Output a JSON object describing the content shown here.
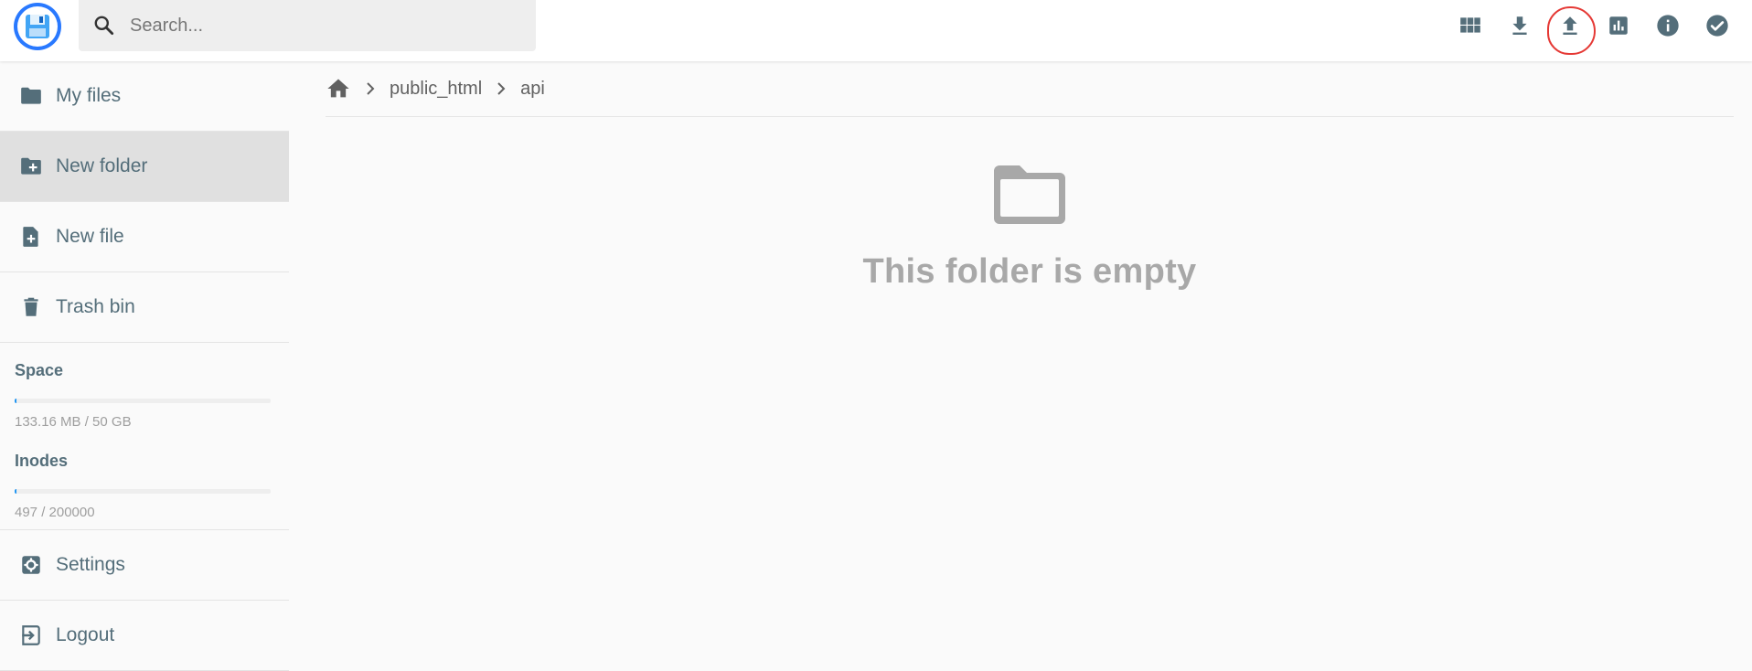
{
  "header": {
    "logo": "floppy-disk-logo",
    "search_placeholder": "Search...",
    "toolbar": [
      {
        "name": "toggle-view-button",
        "icon": "view-module-icon",
        "title": "Switch view"
      },
      {
        "name": "download-button",
        "icon": "download-icon",
        "title": "Download"
      },
      {
        "name": "upload-button",
        "icon": "upload-icon",
        "title": "Upload"
      },
      {
        "name": "statistics-button",
        "icon": "bar-chart-icon",
        "title": "Info"
      },
      {
        "name": "info-button",
        "icon": "info-icon",
        "title": "Info"
      },
      {
        "name": "select-multiple-button",
        "icon": "check-circle-icon",
        "title": "Select multiple"
      }
    ],
    "annotation_color": "#e53935"
  },
  "sidebar": {
    "items": [
      {
        "label": "My files",
        "icon": "folder-icon"
      },
      {
        "label": "New folder",
        "icon": "folder-plus-icon"
      },
      {
        "label": "New file",
        "icon": "file-plus-icon"
      },
      {
        "label": "Trash bin",
        "icon": "trash-icon"
      }
    ],
    "space": {
      "title": "Space",
      "text": "133.16 MB / 50 GB",
      "fraction": 0.0026
    },
    "inodes": {
      "title": "Inodes",
      "text": "497 / 200000",
      "fraction": 0.0025
    },
    "bottom_items": [
      {
        "label": "Settings",
        "icon": "gear-icon"
      },
      {
        "label": "Logout",
        "icon": "logout-icon"
      }
    ]
  },
  "breadcrumbs": {
    "home_icon": "home-icon",
    "items": [
      "public_html",
      "api"
    ]
  },
  "main": {
    "empty_message": "This folder is empty",
    "empty_icon": "folder-outline-icon"
  },
  "colors": {
    "accent": "#2196f3",
    "text": "#546e7a",
    "active_bg": "#e0e0e0"
  }
}
